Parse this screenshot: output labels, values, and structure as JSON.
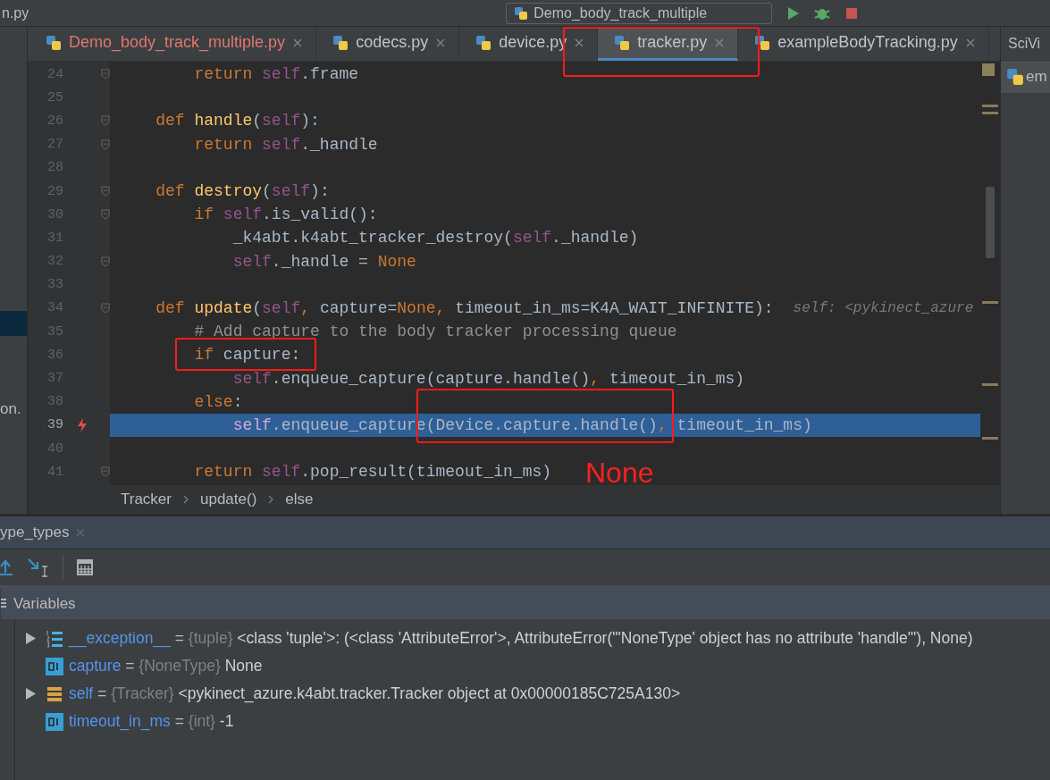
{
  "top_bar": {
    "file_label": "n.py",
    "run_config": "Demo_body_track_multiple"
  },
  "tabs": [
    {
      "label": "Demo_body_track_multiple.py",
      "selected": false,
      "error": true
    },
    {
      "label": "codecs.py",
      "selected": false,
      "error": false
    },
    {
      "label": "device.py",
      "selected": false,
      "error": false
    },
    {
      "label": "tracker.py",
      "selected": true,
      "error": false
    },
    {
      "label": "exampleBodyTracking.py",
      "selected": false,
      "error": false
    }
  ],
  "project_panel": {
    "item": "on."
  },
  "editor": {
    "lines": [
      {
        "number": "24",
        "current": false,
        "exception": false,
        "folding": true,
        "tokens": [
          {
            "kind": "kw",
            "text": "        return"
          },
          {
            "kind": "self",
            "text": " self"
          },
          {
            "kind": "plain",
            "text": ".frame"
          }
        ]
      },
      {
        "number": "25",
        "current": false,
        "exception": false,
        "folding": false
      },
      {
        "number": "26",
        "current": false,
        "exception": false,
        "folding": true,
        "tokens": [
          {
            "kind": "kw",
            "text": "    def"
          },
          {
            "kind": "fn",
            "text": " handle"
          },
          {
            "kind": "plain",
            "text": "("
          },
          {
            "kind": "self",
            "text": "self"
          },
          {
            "kind": "plain",
            "text": "):"
          }
        ]
      },
      {
        "number": "27",
        "current": false,
        "exception": false,
        "folding": true,
        "tokens": [
          {
            "kind": "kw",
            "text": "        return"
          },
          {
            "kind": "self",
            "text": " self"
          },
          {
            "kind": "plain",
            "text": "._handle"
          }
        ]
      },
      {
        "number": "28",
        "current": false,
        "exception": false,
        "folding": false
      },
      {
        "number": "29",
        "current": false,
        "exception": false,
        "folding": true,
        "tokens": [
          {
            "kind": "kw",
            "text": "    def"
          },
          {
            "kind": "fn",
            "text": " destroy"
          },
          {
            "kind": "plain",
            "text": "("
          },
          {
            "kind": "self",
            "text": "self"
          },
          {
            "kind": "plain",
            "text": "):"
          }
        ]
      },
      {
        "number": "30",
        "current": false,
        "exception": false,
        "folding": true,
        "tokens": [
          {
            "kind": "kw",
            "text": "        if"
          },
          {
            "kind": "self",
            "text": " self"
          },
          {
            "kind": "plain",
            "text": ".is_valid():"
          }
        ]
      },
      {
        "number": "31",
        "current": false,
        "exception": false,
        "folding": false,
        "tokens": [
          {
            "kind": "plain",
            "text": "            _k4abt.k4abt_tracker_destroy("
          },
          {
            "kind": "self",
            "text": "self"
          },
          {
            "kind": "plain",
            "text": "._handle)"
          }
        ]
      },
      {
        "number": "32",
        "current": false,
        "exception": false,
        "folding": true,
        "tokens": [
          {
            "kind": "self",
            "text": "            self"
          },
          {
            "kind": "plain",
            "text": "._handle = "
          },
          {
            "kind": "kw",
            "text": "None"
          }
        ]
      },
      {
        "number": "33",
        "current": false,
        "exception": false,
        "folding": false
      },
      {
        "number": "34",
        "current": false,
        "exception": false,
        "folding": true,
        "tokens": [
          {
            "kind": "kw",
            "text": "    def"
          },
          {
            "kind": "fn",
            "text": " update"
          },
          {
            "kind": "plain",
            "text": "("
          },
          {
            "kind": "self",
            "text": "self"
          },
          {
            "kind": "kw",
            "text": ","
          },
          {
            "kind": "plain",
            "text": " capture="
          },
          {
            "kind": "kw",
            "text": "None"
          },
          {
            "kind": "kw",
            "text": ","
          },
          {
            "kind": "plain",
            "text": " timeout_in_ms=K4A_WAIT_INFINITE):"
          }
        ],
        "hint": "self: <pykinect_azure"
      },
      {
        "number": "35",
        "current": false,
        "exception": false,
        "folding": false,
        "tokens": [
          {
            "kind": "comment",
            "text": "        # Add capture to the body tracker processing queue"
          }
        ]
      },
      {
        "number": "36",
        "current": false,
        "exception": false,
        "folding": false,
        "tokens": [
          {
            "kind": "kw",
            "text": "        if"
          },
          {
            "kind": "plain",
            "text": " capture:"
          }
        ]
      },
      {
        "number": "37",
        "current": false,
        "exception": false,
        "folding": false,
        "tokens": [
          {
            "kind": "self",
            "text": "            self"
          },
          {
            "kind": "plain",
            "text": ".enqueue_capture(capture.handle()"
          },
          {
            "kind": "kw",
            "text": ","
          },
          {
            "kind": "plain",
            "text": " timeout_in_ms)"
          }
        ]
      },
      {
        "number": "38",
        "current": false,
        "exception": false,
        "folding": false,
        "tokens": [
          {
            "kind": "kw",
            "text": "        else"
          },
          {
            "kind": "plain",
            "text": ":"
          }
        ]
      },
      {
        "number": "39",
        "current": true,
        "exception": true,
        "folding": false,
        "tokens": [
          {
            "kind": "self",
            "text": "            self"
          },
          {
            "kind": "plain",
            "text": ".enqueue_capture(Device.capture.handle()"
          },
          {
            "kind": "kw",
            "text": ","
          },
          {
            "kind": "plain",
            "text": " timeout_in_ms)"
          }
        ]
      },
      {
        "number": "40",
        "current": false,
        "exception": false,
        "folding": false
      },
      {
        "number": "41",
        "current": false,
        "exception": false,
        "folding": true,
        "tokens": [
          {
            "kind": "kw",
            "text": "        return"
          },
          {
            "kind": "self",
            "text": " self"
          },
          {
            "kind": "plain",
            "text": ".pop_result(timeout_in_ms)"
          }
        ]
      }
    ],
    "breadcrumbs": [
      "Tracker",
      "update()",
      "else"
    ]
  },
  "side_panel": {
    "tab": "SciVi",
    "item": "em"
  },
  "annotations": [
    {
      "kind": "box"
    },
    {
      "kind": "box"
    },
    {
      "kind": "box"
    },
    {
      "kind": "label",
      "text": "None"
    }
  ],
  "debug_panel": {
    "tab": "ype_types",
    "section": "Variables",
    "variables": [
      {
        "kind": "tuple",
        "expandable": true,
        "name": "__exception__",
        "separator": "=",
        "type": "{tuple}",
        "value": "<class 'tuple'>: (<class 'AttributeError'>, AttributeError(\"'NoneType' object has no attribute 'handle'\"), None)"
      },
      {
        "kind": "int",
        "expandable": false,
        "name": "capture",
        "separator": "=",
        "type": "{NoneType}",
        "value": "None"
      },
      {
        "kind": "object",
        "expandable": true,
        "name": "self",
        "separator": "=",
        "type": "{Tracker}",
        "value": "<pykinect_azure.k4abt.tracker.Tracker object at 0x00000185C725A130>"
      },
      {
        "kind": "int",
        "expandable": false,
        "name": "timeout_in_ms",
        "separator": "=",
        "type": "{int}",
        "value": "-1"
      }
    ]
  }
}
